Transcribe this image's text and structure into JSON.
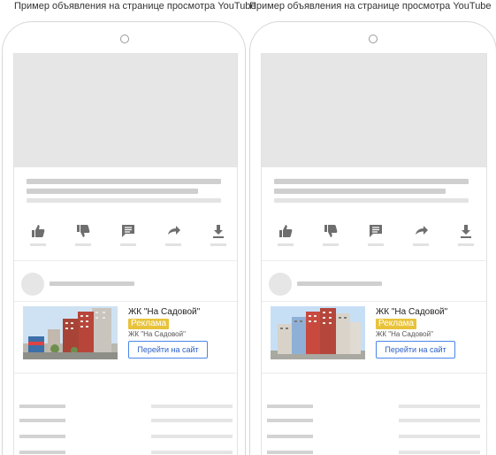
{
  "panels": [
    {
      "caption": "Пример объявления на странице просмотра YouTube",
      "ad": {
        "title": "ЖК \"На Садовой\"",
        "badge": "Реклама",
        "subtitle": "ЖК \"На Садовой\"",
        "button": "Перейти на сайт"
      }
    },
    {
      "caption": "Пример объявления на странице просмотра YouTube",
      "ad": {
        "title": "ЖК \"На Садовой\"",
        "badge": "Реклама",
        "subtitle": "ЖК \"На Садовой\"",
        "button": "Перейти на сайт"
      }
    }
  ],
  "actions": [
    "thumbs-up-icon",
    "thumbs-down-icon",
    "comment-icon",
    "share-icon",
    "download-icon"
  ],
  "colors": {
    "badge": "#e8c33a",
    "button_border": "#4a86e8",
    "placeholder": "#e6e6e6"
  }
}
